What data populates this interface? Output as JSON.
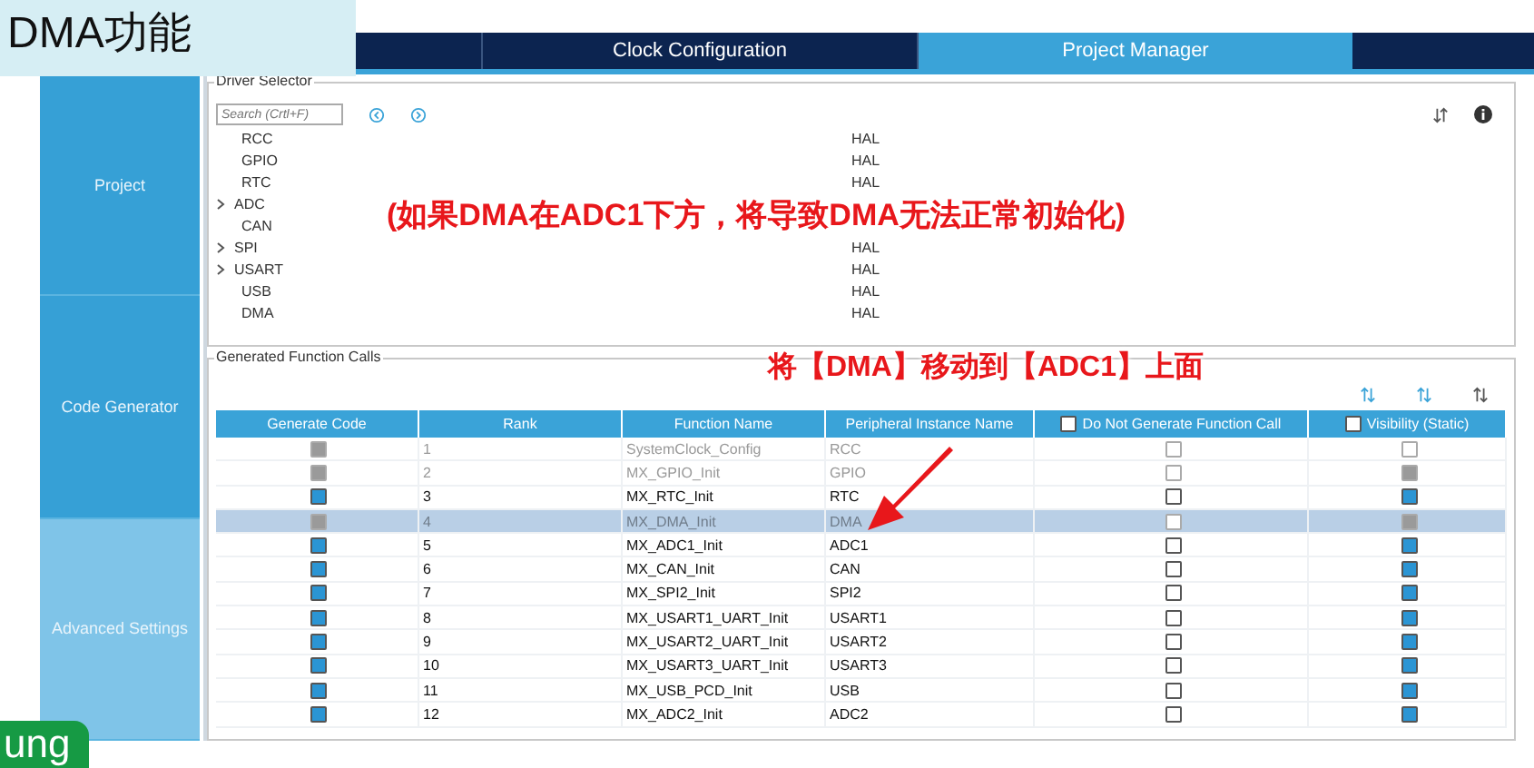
{
  "overlay_title": "DMA功能",
  "tabs": [
    {
      "label": "Clock Configuration",
      "selected": false
    },
    {
      "label": "Project Manager",
      "selected": true
    }
  ],
  "sidebar": [
    {
      "label": "Project",
      "selected": false
    },
    {
      "label": "Code Generator",
      "selected": false
    },
    {
      "label": "Advanced Settings",
      "selected": true
    }
  ],
  "driver_selector": {
    "title": "Driver Selector",
    "search": {
      "placeholder": "Search (Crtl+F)"
    },
    "rows": [
      {
        "name": "RCC",
        "expandable": false,
        "driver": "HAL"
      },
      {
        "name": "GPIO",
        "expandable": false,
        "driver": "HAL"
      },
      {
        "name": "RTC",
        "expandable": false,
        "driver": "HAL"
      },
      {
        "name": "ADC",
        "expandable": true
      },
      {
        "name": "CAN",
        "expandable": false
      },
      {
        "name": "SPI",
        "expandable": true,
        "driver": "HAL"
      },
      {
        "name": "USART",
        "expandable": true,
        "driver": "HAL"
      },
      {
        "name": "USB",
        "expandable": false,
        "driver": "HAL"
      },
      {
        "name": "DMA",
        "expandable": false,
        "driver": "HAL"
      }
    ]
  },
  "annotation_1": "(如果DMA在ADC1下方，将导致DMA无法正常初始化)",
  "annotation_2": "将【DMA】移动到【ADC1】上面",
  "function_calls": {
    "title": "Generated Function Calls",
    "columns": [
      {
        "label": "Generate Code"
      },
      {
        "label": "Rank"
      },
      {
        "label": "Function Name"
      },
      {
        "label": "Peripheral Instance Name"
      },
      {
        "label": "Do Not Generate Function Call",
        "checked": false
      },
      {
        "label": "Visibility (Static)",
        "checked": false
      }
    ],
    "rows": [
      {
        "rank": "1",
        "function": "SystemClock_Config",
        "peripheral": "RCC",
        "disabled": true,
        "selected": false,
        "generate_code": true,
        "do_not_generate": false,
        "visibility": false
      },
      {
        "rank": "2",
        "function": "MX_GPIO_Init",
        "peripheral": "GPIO",
        "disabled": true,
        "selected": false,
        "generate_code": true,
        "do_not_generate": false,
        "visibility": true
      },
      {
        "rank": "3",
        "function": "MX_RTC_Init",
        "peripheral": "RTC",
        "disabled": false,
        "selected": false,
        "generate_code": true,
        "do_not_generate": false,
        "visibility": true
      },
      {
        "rank": "4",
        "function": "MX_DMA_Init",
        "peripheral": "DMA",
        "disabled": true,
        "selected": true,
        "generate_code": true,
        "do_not_generate": false,
        "visibility": true
      },
      {
        "rank": "5",
        "function": "MX_ADC1_Init",
        "peripheral": "ADC1",
        "disabled": false,
        "selected": false,
        "generate_code": true,
        "do_not_generate": false,
        "visibility": true
      },
      {
        "rank": "6",
        "function": "MX_CAN_Init",
        "peripheral": "CAN",
        "disabled": false,
        "selected": false,
        "generate_code": true,
        "do_not_generate": false,
        "visibility": true
      },
      {
        "rank": "7",
        "function": "MX_SPI2_Init",
        "peripheral": "SPI2",
        "disabled": false,
        "selected": false,
        "generate_code": true,
        "do_not_generate": false,
        "visibility": true
      },
      {
        "rank": "8",
        "function": "MX_USART1_UART_Init",
        "peripheral": "USART1",
        "disabled": false,
        "selected": false,
        "generate_code": true,
        "do_not_generate": false,
        "visibility": true
      },
      {
        "rank": "9",
        "function": "MX_USART2_UART_Init",
        "peripheral": "USART2",
        "disabled": false,
        "selected": false,
        "generate_code": true,
        "do_not_generate": false,
        "visibility": true
      },
      {
        "rank": "10",
        "function": "MX_USART3_UART_Init",
        "peripheral": "USART3",
        "disabled": false,
        "selected": false,
        "generate_code": true,
        "do_not_generate": false,
        "visibility": true
      },
      {
        "rank": "11",
        "function": "MX_USB_PCD_Init",
        "peripheral": "USB",
        "disabled": false,
        "selected": false,
        "generate_code": true,
        "do_not_generate": false,
        "visibility": true
      },
      {
        "rank": "12",
        "function": "MX_ADC2_Init",
        "peripheral": "ADC2",
        "disabled": false,
        "selected": false,
        "generate_code": true,
        "do_not_generate": false,
        "visibility": true
      }
    ]
  },
  "caption_badge": "ung"
}
